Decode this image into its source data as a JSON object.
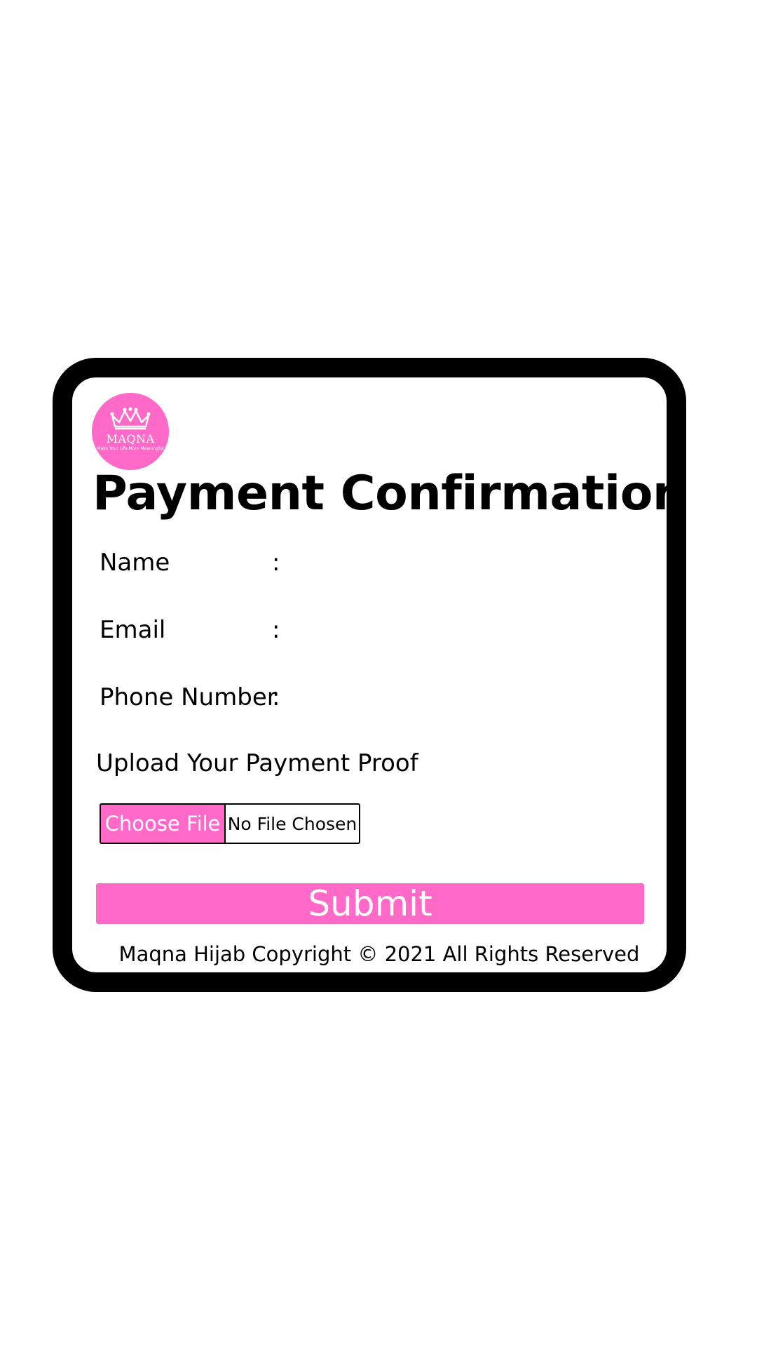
{
  "brand": {
    "name": "MAQNA",
    "tagline": "Make Your Life More Meaningful",
    "accent_color": "#ff69c8"
  },
  "page": {
    "title": "Payment Confirmation"
  },
  "form": {
    "fields": [
      {
        "label": "Name",
        "colon": ":",
        "value": ""
      },
      {
        "label": "Email",
        "colon": ":",
        "value": ""
      },
      {
        "label": "Phone Number",
        "colon": ":",
        "value": ""
      }
    ],
    "upload_label": "Upload Your Payment Proof",
    "choose_file_label": "Choose File",
    "file_status": "No File Chosen",
    "submit_label": "Submit"
  },
  "footer": {
    "text": "Maqna Hijab Copyright © 2021 All Rights Reserved"
  }
}
